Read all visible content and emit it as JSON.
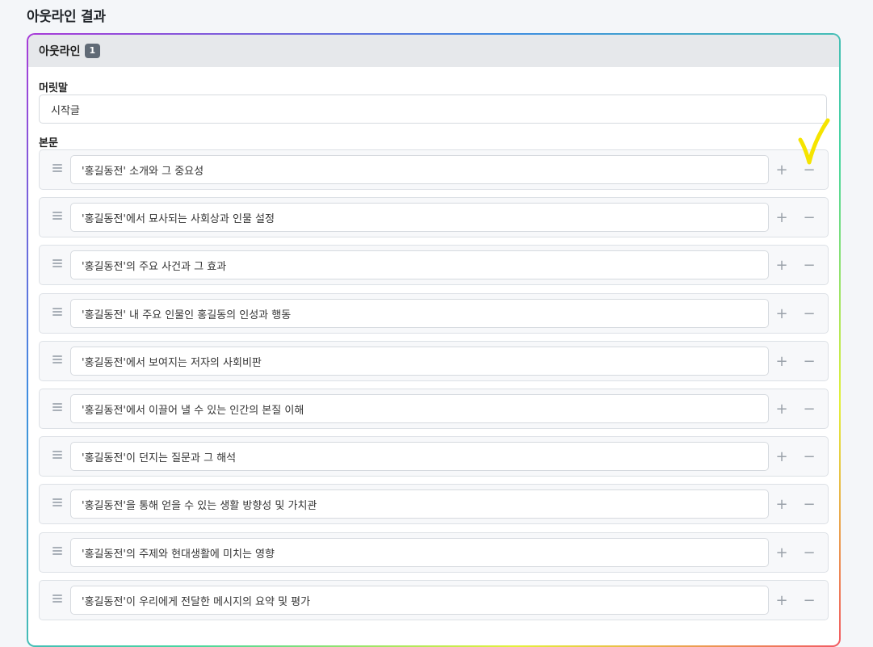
{
  "page": {
    "title": "아웃라인 결과"
  },
  "outline": {
    "header_label": "아웃라인",
    "count": "1",
    "preface_label": "머릿말",
    "preface_value": "시작글",
    "body_label": "본문",
    "add_symbol": "+",
    "remove_symbol": "−",
    "items": [
      "'홍길동전' 소개와 그 중요성",
      "'홍길동전'에서 묘사되는 사회상과 인물 설정",
      "'홍길동전'의 주요 사건과 그 효과",
      "'홍길동전' 내 주요 인물인 홍길동의 인성과 행동",
      "'홍길동전'에서 보여지는 저자의 사회비판",
      "'홍길동전'에서 이끌어 낼 수 있는 인간의 본질 이해",
      "'홍길동전'이 던지는 질문과 그 해석",
      "'홍길동전'을 통해 얻을 수 있는 생활 방향성 및 가치관",
      "'홍길동전'의 주제와 현대생활에 미치는 영향",
      "'홍길동전'이 우리에게 전달한 메시지의 요약 및 평가"
    ]
  },
  "icons": {
    "drag": "drag-handle-icon",
    "check": "checkmark-icon",
    "check_color": "#f5e400"
  }
}
